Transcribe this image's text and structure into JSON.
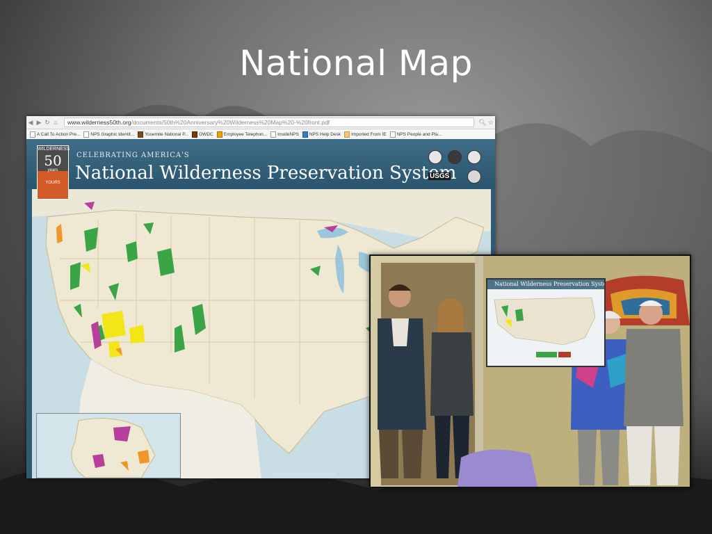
{
  "slide": {
    "title": "National Map"
  },
  "browser": {
    "url_host": "www.wilderness50th.org",
    "url_path": "/documents/50th%20Anniversary%20Wilderness%20Map%20-%20front.pdf",
    "bookmarks": [
      "A Call To Action Pre...",
      "NPS Graphic Identit...",
      "Yosemite National P...",
      "OWDC",
      "Employee Telephon...",
      "InsideNPS",
      "NPS Help Desk",
      "Imported From IE",
      "NPS People and Pla..."
    ]
  },
  "poster": {
    "badge_wilderness": "WILDERNESS",
    "badge_number": "50",
    "badge_years": "years",
    "badge_yours": "YOURS",
    "celebrating": "CELEBRATING AMERICA'S",
    "title": "National Wilderness Preservation System",
    "usgs": "USGS",
    "caption": "Designated Wilderness Areas"
  },
  "photo": {
    "poster_title": "National Wilderness Preservation System"
  },
  "colors": {
    "wilderness_green": "#3aa447",
    "wilderness_yellow": "#f2e619",
    "wilderness_magenta": "#b6409c",
    "wilderness_orange": "#f0962a",
    "banner_blue": "#2f5b74"
  }
}
